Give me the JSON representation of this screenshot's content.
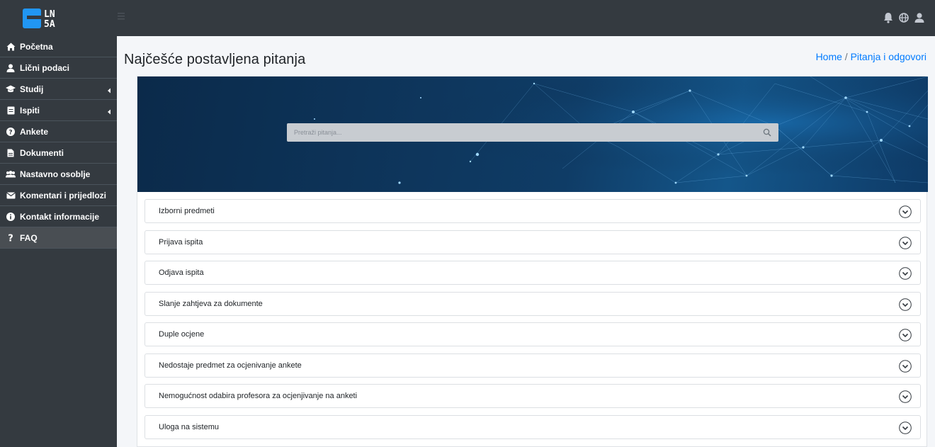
{
  "app": {
    "logo_text": [
      "LN",
      "5A"
    ]
  },
  "sidebar": {
    "items": [
      {
        "label": "Početna",
        "icon": "home-icon"
      },
      {
        "label": "Lični podaci",
        "icon": "user-icon"
      },
      {
        "label": "Studij",
        "icon": "graduation-cap-icon",
        "has_submenu": true
      },
      {
        "label": "Ispiti",
        "icon": "exam-icon",
        "has_submenu": true
      },
      {
        "label": "Ankete",
        "icon": "question-circle-icon"
      },
      {
        "label": "Dokumenti",
        "icon": "document-icon"
      },
      {
        "label": "Nastavno osoblje",
        "icon": "users-icon"
      },
      {
        "label": "Komentari i prijedlozi",
        "icon": "envelope-icon"
      },
      {
        "label": "Kontakt informacije",
        "icon": "info-circle-icon"
      },
      {
        "label": "FAQ",
        "icon": "question-mark-icon",
        "active": true
      }
    ]
  },
  "topbar": {
    "icons": [
      "bell-icon",
      "globe-icon",
      "user-icon"
    ]
  },
  "main": {
    "title": "Najčešće postavljena pitanja",
    "breadcrumb": {
      "home": "Home",
      "separator": " / ",
      "current": "Pitanja i odgovori"
    },
    "search": {
      "placeholder": "Pretraži pitanja...",
      "value": ""
    },
    "faq": [
      "Izborni predmeti",
      "Prijava ispita",
      "Odjava ispita",
      "Slanje zahtjeva za dokumente",
      "Duple ocjene",
      "Nedostaje predmet za ocjenivanje ankete",
      "Nemogućnost odabira profesora za ocjenjivanje na anketi",
      "Uloga na sistemu"
    ]
  },
  "colors": {
    "sidebar_bg": "#343a40",
    "active_item_bg": "#494e53",
    "link": "#007bff",
    "logo_blue": "#1e88e5"
  }
}
